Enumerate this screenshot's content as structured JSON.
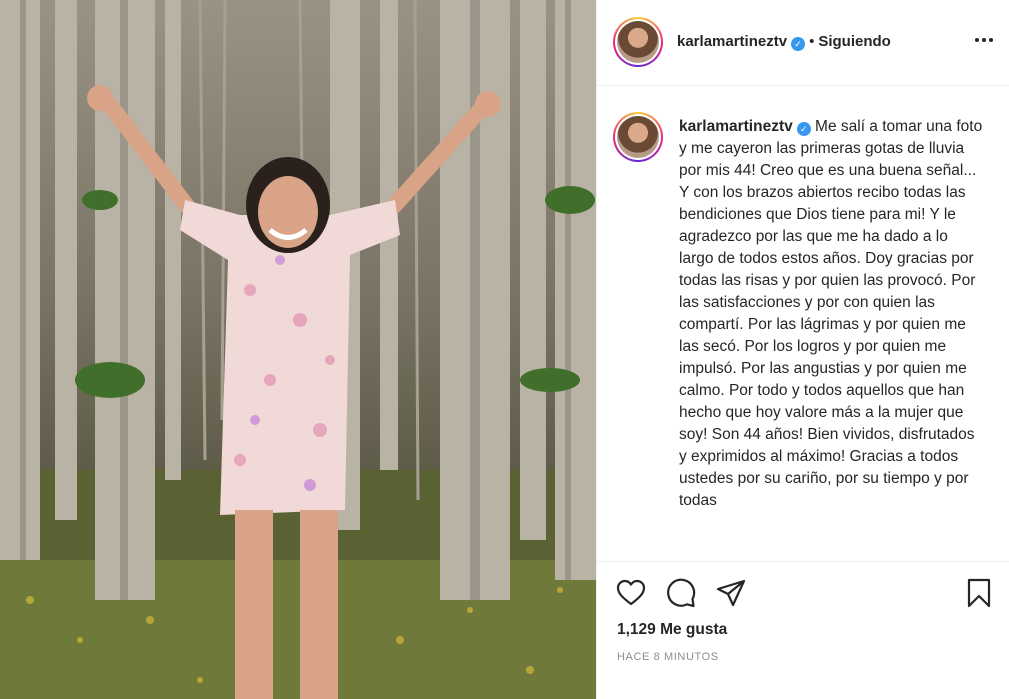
{
  "post": {
    "author": "karlamartineztv",
    "verified_mark": "✓",
    "separator": "•",
    "follow_state": "Siguiendo",
    "caption": "Me salí a tomar una foto y me cayeron las primeras gotas de lluvia por mis 44! Creo que es una buena señal... Y con los brazos abiertos recibo todas las bendiciones que Dios tiene para mi! Y le agradezco por las que me ha dado a lo largo de todos estos años. Doy gracias por todas las risas y por quien las provocó. Por las satisfacciones y por con quien las compartí. Por las lágrimas y por quien me las secó. Por los logros y por quien me impulsó. Por las angustias y por quien me calmo. Por todo y todos aquellos que han hecho que hoy valore más a la mujer que soy! Son 44 años! Bien vividos, disfrutados y exprimidos al máximo! Gracias a todos ustedes por su cariño, por su tiempo y por todas",
    "likes": "1,129 Me gusta",
    "timestamp": "Hace 8 minutos"
  },
  "icons": {
    "more": "more-options-icon",
    "like": "heart-icon",
    "comment": "comment-icon",
    "share": "share-icon",
    "save": "bookmark-icon",
    "verified": "verified-badge-icon"
  },
  "colors": {
    "verified": "#3897f0",
    "text": "#262626",
    "muted": "#8e8e8e",
    "border": "#efefef"
  }
}
